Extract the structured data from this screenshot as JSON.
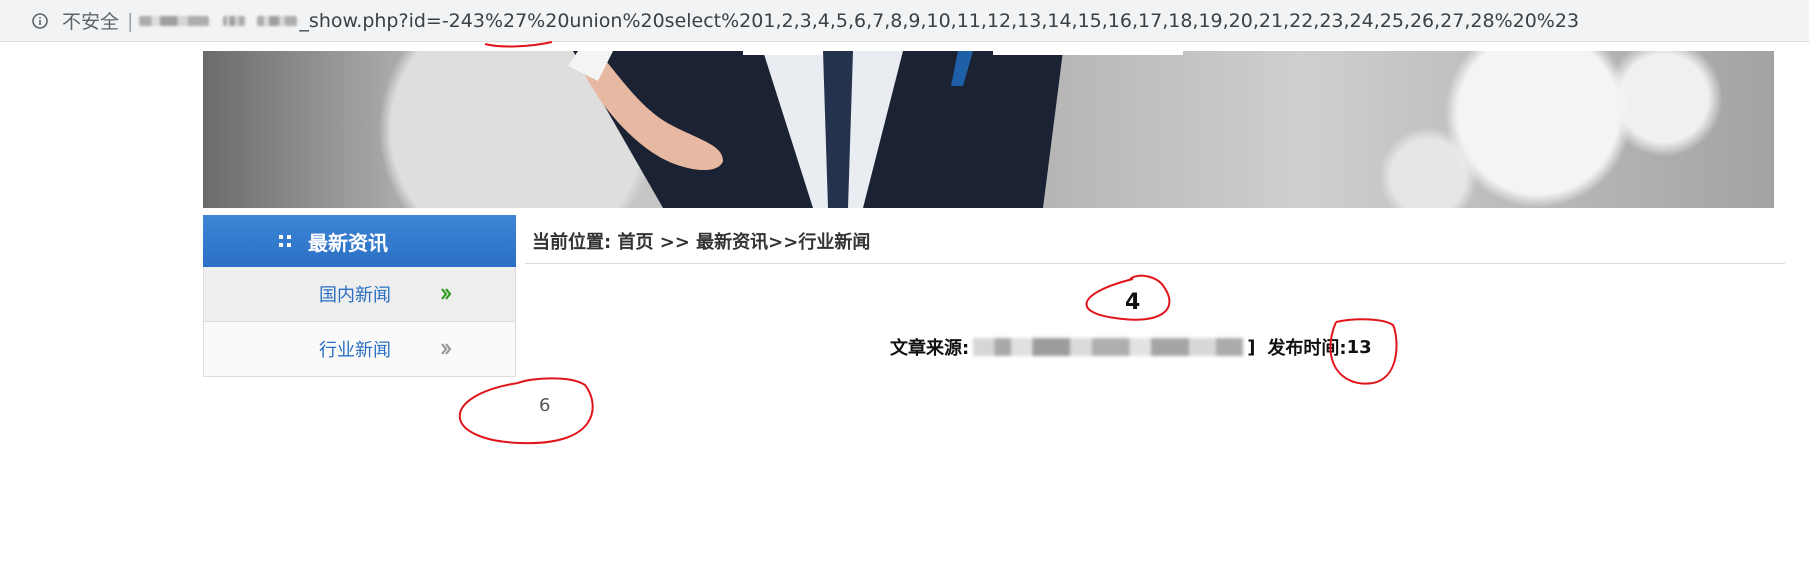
{
  "browser": {
    "security_label": "不安全",
    "separator": "|",
    "url_visible": "_show.php?id=-243%27%20union%20select%201,2,3,4,5,6,7,8,9,10,11,12,13,14,15,16,17,18,19,20,21,22,23,24,25,26,27,28%20%23"
  },
  "sidebar": {
    "header": "最新资讯",
    "items": [
      {
        "label": "国内新闻"
      },
      {
        "label": "行业新闻"
      }
    ]
  },
  "breadcrumb": "当前位置: 首页 >> 最新资讯>>行业新闻",
  "article": {
    "title": "4",
    "source_label": "文章来源:",
    "source_end": "]",
    "publish_label": "发布时间:",
    "publish_value": "13"
  },
  "pagination": "6",
  "colors": {
    "sidebar_header": "#2a6fc4",
    "link": "#2a6fc4",
    "annotation": "#e0151b"
  }
}
